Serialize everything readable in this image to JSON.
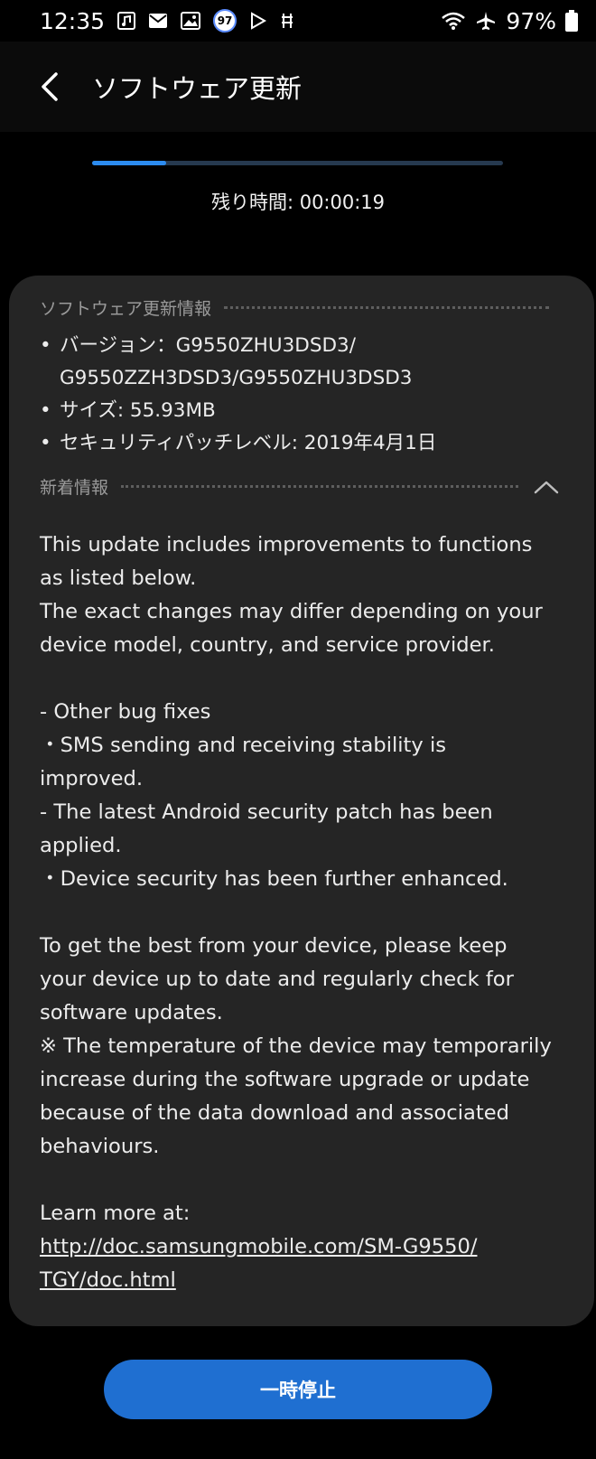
{
  "status_bar": {
    "time": "12:35",
    "notif_badge": "97",
    "battery": "97%"
  },
  "app_bar": {
    "title": "ソフトウェア更新"
  },
  "progress": {
    "fraction": 0.18,
    "remaining_text": "残り時間: 00:00:19"
  },
  "update_info": {
    "heading": "ソフトウェア更新情報",
    "version_line1": "バージョン：G9550ZHU3DSD3/",
    "version_line2": "G9550ZZH3DSD3/G9550ZHU3DSD3",
    "size": "サイズ: 55.93MB",
    "security_patch": "セキュリティパッチレベル: 2019年4月1日"
  },
  "whats_new": {
    "heading": "新着情報",
    "line1": "This update includes improvements to functions",
    "line2": "as listed below.",
    "line3": "The exact changes may differ depending on your",
    "line4": "device model, country, and service provider.",
    "line5": "- Other bug fixes",
    "line6": "・SMS sending and receiving stability is",
    "line7": "improved.",
    "line8": "- The latest Android security patch has been",
    "line9": "applied.",
    "line10": "・Device security has been further enhanced.",
    "line11": "To get the best from your device, please keep",
    "line12": "your device up to date and regularly check for",
    "line13": "software updates.",
    "line14": "※ The temperature of the device may temporarily",
    "line15": "increase during the software upgrade or update",
    "line16": "because of the data download and associated",
    "line17": "behaviours.",
    "learn_more": "Learn more at:",
    "link_line1": "http://doc.samsungmobile.com/SM-G9550/",
    "link_line2": "TGY/doc.html"
  },
  "pause_button": {
    "label": "一時停止"
  },
  "colors": {
    "background": "#000000",
    "card": "#252525",
    "accent": "#2c8cf0",
    "button": "#1f6fd1"
  }
}
